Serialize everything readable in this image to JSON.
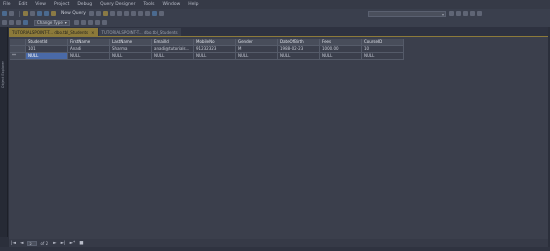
{
  "menu": {
    "items": [
      "File",
      "Edit",
      "View",
      "Project",
      "Debug",
      "Query Designer",
      "Tools",
      "Window",
      "Help"
    ]
  },
  "toolbar": {
    "new_query_label": "New Query",
    "change_type_label": "Change Type",
    "search_combo_value": ""
  },
  "tabs": [
    {
      "label": "TUTORIALSPOINT-T... dbo.tbl_Students",
      "active": true,
      "close": "×"
    },
    {
      "label": "TUTORIALSPOINT-T... dbo.tbl_Students",
      "active": false,
      "close": ""
    }
  ],
  "side": {
    "label": "Object Explorer"
  },
  "grid": {
    "columns": [
      "StudentId",
      "FirstName",
      "LastName",
      "EmailId",
      "MobileNo",
      "Gender",
      "DateOfBirth",
      "Fees",
      "CourseID"
    ],
    "rows": [
      {
        "marker": "",
        "cells": [
          "101",
          "Anadi",
          "Sharma",
          "anadi@tutorials...",
          "91232323",
          "M",
          "1988-02-23",
          "1000.00",
          "10"
        ]
      },
      {
        "marker": "**",
        "cells": [
          "NULL",
          "NULL",
          "NULL",
          "NULL",
          "NULL",
          "NULL",
          "NULL",
          "NULL",
          "NULL"
        ]
      }
    ]
  },
  "nav": {
    "first": "|◄",
    "prev": "◄",
    "current": "2",
    "of_text": "of 2",
    "next": "►",
    "last": "►|",
    "new": "►*",
    "stop": "■"
  }
}
